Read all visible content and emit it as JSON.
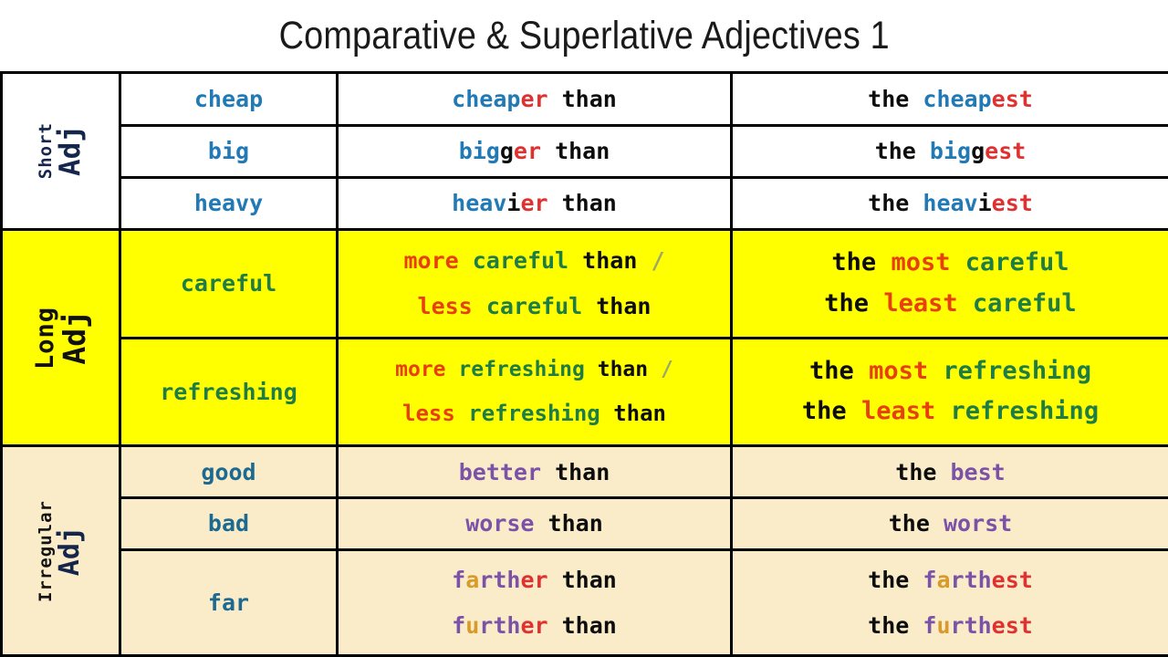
{
  "page": {
    "title": "Comparative & Superlative Adjectives 1"
  },
  "colors": {
    "stem_blue": "#2179b5",
    "stem_teal": "#1c6a91",
    "suffix_red": "#e03131",
    "black": "#0d0d0d",
    "green": "#1e7d45",
    "orange_red": "#e8400c",
    "purple": "#7b52a8",
    "gold": "#d89a2b",
    "slash_olive": "#9aa86a",
    "row_short_bg": "#ffffff",
    "row_long_bg": "#ffff00",
    "row_irregular_bg": "#faecc8",
    "border": "#000000",
    "label_navy": "#14264b"
  },
  "sections": [
    {
      "key": "short",
      "label_qualifier": "Short",
      "label_adj": "Adj",
      "rows": [
        {
          "base": "cheap",
          "comparative": {
            "stem": "cheap",
            "suffix": "er",
            "than": "than"
          },
          "superlative": {
            "the": "the",
            "stem": "cheap",
            "suffix": "est"
          }
        },
        {
          "base": "big",
          "comparative": {
            "stem": "big",
            "double": "g",
            "suffix": "er",
            "than": "than"
          },
          "superlative": {
            "the": "the",
            "stem": "big",
            "double": "g",
            "suffix": "est"
          }
        },
        {
          "base": "heavy",
          "comparative": {
            "stem": "heav",
            "double": "i",
            "suffix": "er",
            "than": "than"
          },
          "superlative": {
            "the": "the",
            "stem": "heav",
            "double": "i",
            "suffix": "est"
          }
        }
      ]
    },
    {
      "key": "long",
      "label_qualifier": "Long",
      "label_adj": "Adj",
      "rows": [
        {
          "base": "careful",
          "comparative": {
            "more": "more",
            "adj": "careful",
            "than": "than",
            "slash": "/",
            "less": "less",
            "adj2": "careful",
            "than2": "than"
          },
          "superlative": {
            "the": "the",
            "most": "most",
            "adj": "careful",
            "the2": "the",
            "least": "least",
            "adj2": "careful"
          }
        },
        {
          "base": "refreshing",
          "comparative": {
            "more": "more",
            "adj": "refreshing",
            "than": "than",
            "slash": "/",
            "less": "less",
            "adj2": "refreshing",
            "than2": "than"
          },
          "superlative": {
            "the": "the",
            "most": "most",
            "adj": "refreshing",
            "the2": "the",
            "least": "least",
            "adj2": "refreshing"
          }
        }
      ]
    },
    {
      "key": "irregular",
      "label_qualifier": "Irregular",
      "label_adj": "Adj",
      "rows": [
        {
          "base": "good",
          "comparative": {
            "word": "better",
            "than": "than"
          },
          "superlative": {
            "the": "the",
            "word": "best"
          }
        },
        {
          "base": "bad",
          "comparative": {
            "word": "worse",
            "than": "than"
          },
          "superlative": {
            "the": "the",
            "word": "worst"
          }
        },
        {
          "base": "far",
          "comparative": {
            "a_p1": "f",
            "a_vowel": "a",
            "a_p2": "rth",
            "a_suffix": "er",
            "a_than": "than",
            "b_p1": "f",
            "b_vowel": "u",
            "b_p2": "rth",
            "b_suffix": "er",
            "b_than": "than"
          },
          "superlative": {
            "a_the": "the",
            "a_p1": "f",
            "a_vowel": "a",
            "a_p2": "rth",
            "a_suffix": "est",
            "b_the": "the",
            "b_p1": "f",
            "b_vowel": "u",
            "b_p2": "rth",
            "b_suffix": "est"
          }
        }
      ]
    }
  ]
}
